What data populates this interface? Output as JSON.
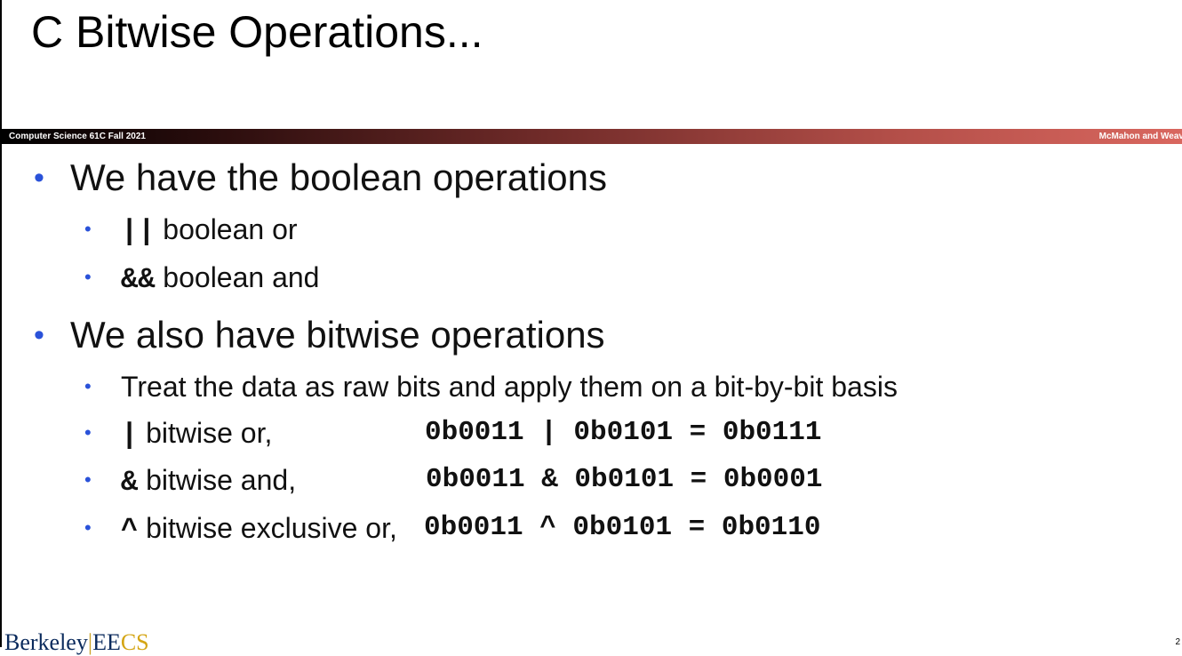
{
  "title": "C Bitwise Operations...",
  "header_bar": {
    "left": "Computer Science 61C Fall 2021",
    "right": "McMahon and Weav"
  },
  "bullets": [
    {
      "text": "We have the boolean operations",
      "sub": [
        {
          "code": "||",
          "text": " boolean or"
        },
        {
          "code": "&&",
          "text": " boolean and"
        }
      ]
    },
    {
      "text": "We also have bitwise operations",
      "sub": [
        {
          "code": "",
          "text": "Treat the data as raw bits and apply them on a bit-by-bit basis"
        },
        {
          "code": "|",
          "text": " bitwise or,",
          "expr": "0b0011 | 0b0101 = 0b0111"
        },
        {
          "code": "&",
          "text": " bitwise and,",
          "expr": "0b0011 & 0b0101 = 0b0001"
        },
        {
          "code": "^",
          "text": " bitwise exclusive or,",
          "expr": "0b0011 ^ 0b0101 = 0b0110"
        }
      ]
    }
  ],
  "footer": {
    "logo_berkeley": "Berkeley",
    "logo_separator": "|",
    "logo_ee": "EE",
    "logo_cs": "CS",
    "page_number": "2"
  },
  "colors": {
    "bullet": "#2a52d9",
    "bar_start": "#000000",
    "bar_end": "#d9675f"
  }
}
